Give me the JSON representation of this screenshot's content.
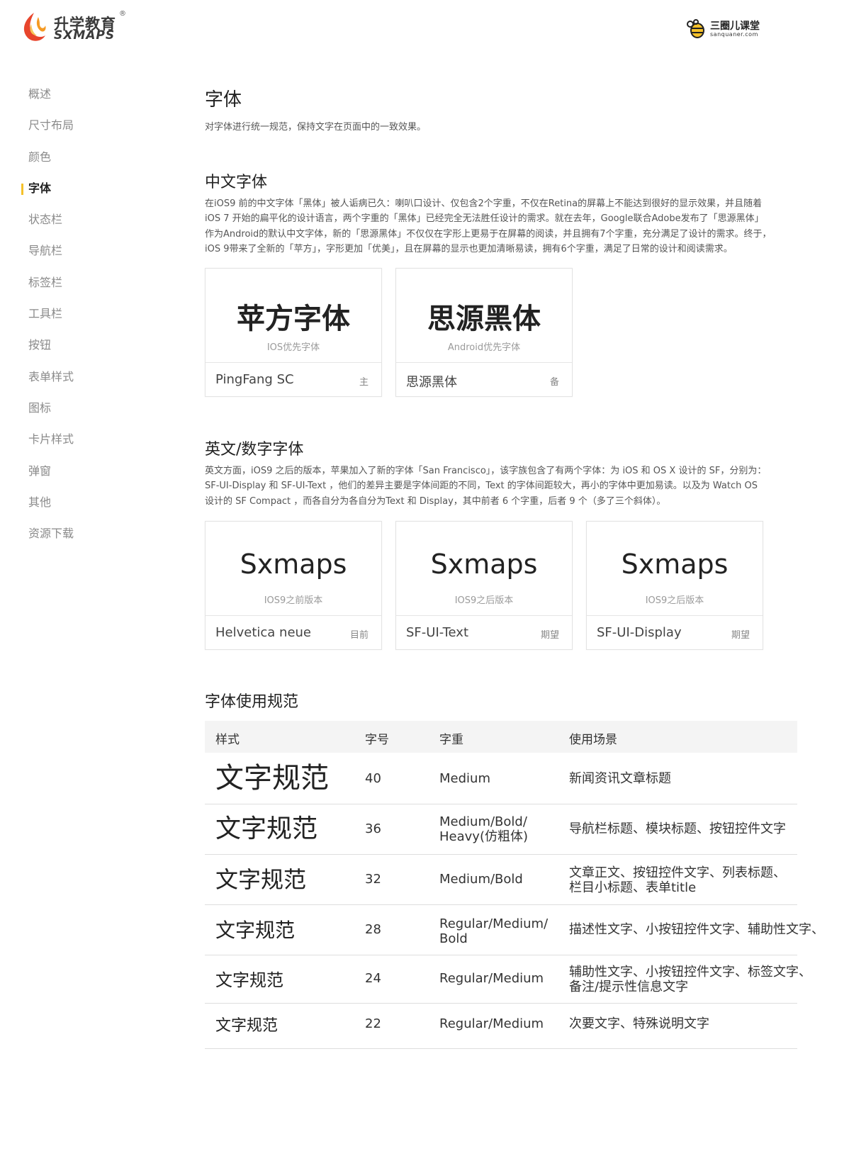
{
  "header": {
    "logo_cn": "升学教育",
    "logo_en": "SXMAPS",
    "logo_reg": "®",
    "partner_cn": "三圈儿课堂",
    "partner_url": "sanquaner.com"
  },
  "colors": {
    "accent": "#f5c12a",
    "brand_red": "#e8452c",
    "brand_orange": "#f59a23"
  },
  "sidebar": {
    "active_index": 3,
    "items": [
      {
        "label": "概述"
      },
      {
        "label": "尺寸布局"
      },
      {
        "label": "颜色"
      },
      {
        "label": "字体"
      },
      {
        "label": "状态栏"
      },
      {
        "label": "导航栏"
      },
      {
        "label": "标签栏"
      },
      {
        "label": "工具栏"
      },
      {
        "label": "按钮"
      },
      {
        "label": "表单样式"
      },
      {
        "label": "图标"
      },
      {
        "label": "卡片样式"
      },
      {
        "label": "弹窗"
      },
      {
        "label": "其他"
      },
      {
        "label": "资源下载"
      }
    ]
  },
  "page": {
    "title": "字体",
    "subtitle": "对字体进行统一规范，保持文字在页面中的一致效果。"
  },
  "chinese_section": {
    "title": "中文字体",
    "lines": [
      "在iOS9 前的中文字体「黑体」被人诟病已久：喇叭口设计、仅包含2个字重，不仅在Retina的屏幕上不能达到很好的显示效果，并且随着",
      "iOS 7 开始的扁平化的设计语言，两个字重的「黑体」已经完全无法胜任设计的需求。就在去年，Google联合Adobe发布了「思源黑体」",
      "作为Android的默认中文字体，新的「思源黑体」不仅仅在字形上更易于在屏幕的阅读，并且拥有7个字重，充分满足了设计的需求。终于，",
      "iOS 9带来了全新的「苹方」，字形更加「优美」，且在屏幕的显示也更加清晰易读，拥有6个字重，满足了日常的设计和阅读需求。"
    ],
    "cards": [
      {
        "sample": "苹方字体",
        "caption": "IOS优先字体",
        "name": "PingFang SC",
        "tag": "主"
      },
      {
        "sample": "思源黑体",
        "caption": "Android优先字体",
        "name": "思源黑体",
        "tag": "备"
      }
    ]
  },
  "english_section": {
    "title": "英文/数字字体",
    "lines": [
      "英文方面，iOS9 之后的版本，苹果加入了新的字体「San Francisco」，该字族包含了有两个字体：为 iOS 和 OS X 设计的 SF，分别为：",
      "SF-UI-Display 和 SF-UI-Text ，他们的差异主要是字体间距的不同，Text 的字体间距较大，再小的字体中更加易读。以及为 Watch OS",
      "设计的 SF Compact ，而各自分为各自分为Text 和 Display，其中前者 6 个字重，后者 9 个（多了三个斜体）。"
    ],
    "cards": [
      {
        "sample": "Sxmaps",
        "caption": "IOS9之前版本",
        "name": "Helvetica neue",
        "tag": "目前"
      },
      {
        "sample": "Sxmaps",
        "caption": "IOS9之后版本",
        "name": "SF-UI-Text",
        "tag": "期望"
      },
      {
        "sample": "Sxmaps",
        "caption": "IOS9之后版本",
        "name": "SF-UI-Display",
        "tag": "期望"
      }
    ]
  },
  "usage_section": {
    "title": "字体使用规范",
    "columns": [
      "样式",
      "字号",
      "字重",
      "使用场景"
    ],
    "rows": [
      {
        "sample": "文字规范",
        "size": "40",
        "weight": [
          "Medium"
        ],
        "usage": [
          "新闻资讯文章标题"
        ]
      },
      {
        "sample": "文字规范",
        "size": "36",
        "weight": [
          "Medium/Bold/",
          "Heavy(仿粗体)"
        ],
        "usage": [
          "导航栏标题、模块标题、按钮控件文字"
        ]
      },
      {
        "sample": "文字规范",
        "size": "32",
        "weight": [
          "Medium/Bold"
        ],
        "usage": [
          "文章正文、按钮控件文字、列表标题、",
          "栏目小标题、表单title"
        ]
      },
      {
        "sample": "文字规范",
        "size": "28",
        "weight": [
          "Regular/Medium/",
          "Bold"
        ],
        "usage": [
          "描述性文字、小按钮控件文字、辅助性文字、"
        ]
      },
      {
        "sample": "文字规范",
        "size": "24",
        "weight": [
          "Regular/Medium"
        ],
        "usage": [
          "辅助性文字、小按钮控件文字、标签文字、",
          "备注/提示性信息文字"
        ]
      },
      {
        "sample": "文字规范",
        "size": "22",
        "weight": [
          "Regular/Medium"
        ],
        "usage": [
          "次要文字、特殊说明文字"
        ]
      }
    ]
  }
}
